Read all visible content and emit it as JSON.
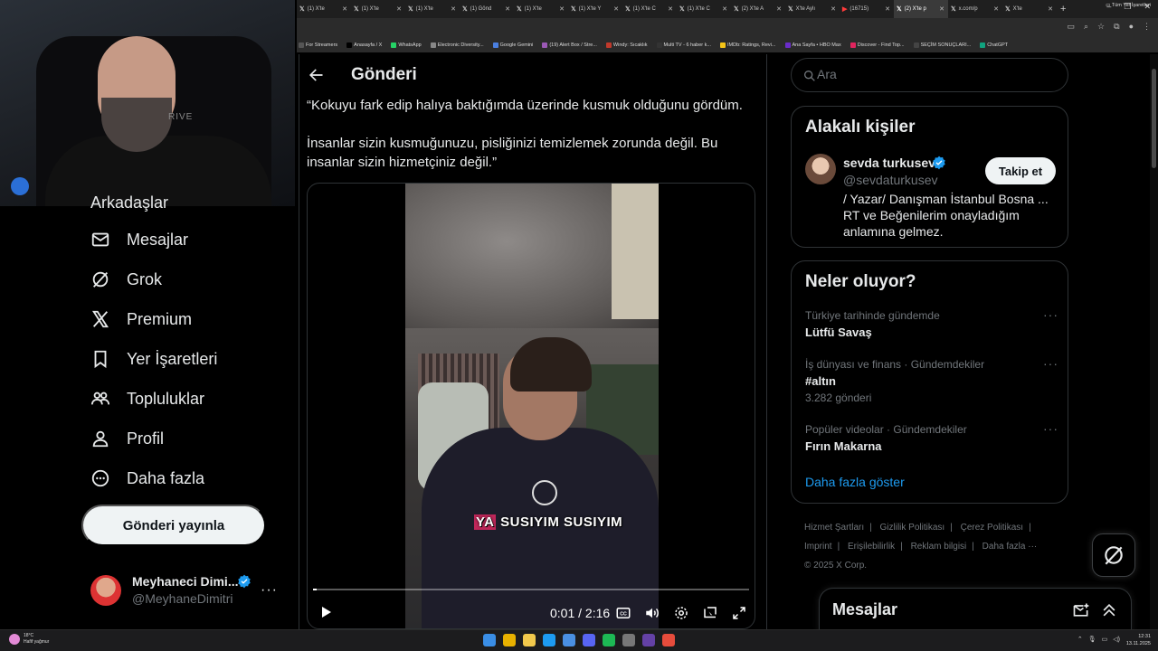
{
  "browser": {
    "tabs": [
      {
        "label": "(1) X'te",
        "icon": "x-icon"
      },
      {
        "label": "(1) X'te",
        "icon": "x-icon"
      },
      {
        "label": "(1) X'te",
        "icon": "x-icon"
      },
      {
        "label": "(1) Gönd",
        "icon": "x-icon"
      },
      {
        "label": "(1) X'te",
        "icon": "x-icon"
      },
      {
        "label": "(1) X'te Y",
        "icon": "x-icon"
      },
      {
        "label": "(1) X'te C",
        "icon": "x-icon"
      },
      {
        "label": "(1) X'te C",
        "icon": "x-icon"
      },
      {
        "label": "(2) X'te A",
        "icon": "x-icon"
      },
      {
        "label": "X'te Aylı",
        "icon": "x-icon"
      },
      {
        "label": "(16715)",
        "icon": "youtube-icon"
      },
      {
        "label": "(2) X'te p",
        "icon": "x-icon",
        "active": true
      },
      {
        "label": "x.com/p",
        "icon": "x-icon"
      },
      {
        "label": "X'te",
        "icon": "x-icon"
      }
    ],
    "bookmarks": [
      {
        "label": "For Streamers",
        "color": "#555555"
      },
      {
        "label": "Anasayfa / X",
        "color": "#000000"
      },
      {
        "label": "WhatsApp",
        "color": "#25d366"
      },
      {
        "label": "Electronic Diversity...",
        "color": "#888888"
      },
      {
        "label": "Google Gemini",
        "color": "#4a7fe0"
      },
      {
        "label": "(19) Alert Box / Stre...",
        "color": "#9b59b6"
      },
      {
        "label": "Windy: Sıcaklık",
        "color": "#c0392b"
      },
      {
        "label": "Multi TV - 6 haber k...",
        "color": "#333333"
      },
      {
        "label": "IMDb: Ratings, Revi...",
        "color": "#f5c518"
      },
      {
        "label": "Ana Sayfa • HBO Max",
        "color": "#6a2cc9"
      },
      {
        "label": "Discover - Find Top...",
        "color": "#e0245e"
      },
      {
        "label": "SEÇİM SONUÇLARI...",
        "color": "#444444"
      },
      {
        "label": "ChatGPT",
        "color": "#10a37f"
      }
    ],
    "bookmarks_more": "Tüm Yer İşaretleri"
  },
  "webcam": {
    "overlay_text": "RIVE"
  },
  "nav": {
    "partial_label": "Arkadaşlar",
    "items": [
      {
        "label": "Mesajlar",
        "icon": "mail-icon"
      },
      {
        "label": "Grok",
        "icon": "grok-icon"
      },
      {
        "label": "Premium",
        "icon": "x-logo-icon"
      },
      {
        "label": "Yer İşaretleri",
        "icon": "bookmark-icon"
      },
      {
        "label": "Topluluklar",
        "icon": "communities-icon"
      },
      {
        "label": "Profil",
        "icon": "profile-icon"
      },
      {
        "label": "Daha fazla",
        "icon": "more-circle-icon"
      }
    ],
    "post_button": "Gönderi yayınla",
    "account": {
      "name": "Meyhaneci Dimi...",
      "handle": "@MeyhaneDimitri",
      "more": "···"
    }
  },
  "post": {
    "header_title": "Gönderi",
    "paragraphs": [
      "“Kokuyu fark edip halıya baktığımda üzerinde kusmuk olduğunu gördüm.",
      "İnsanlar sizin kusmuğunuzu, pisliğinizi temizlemek zorunda değil. Bu insanlar sizin hizmetçiniz değil.”"
    ],
    "video": {
      "caption_highlight": "YA",
      "caption_rest": " SUSIYIM SUSIYIM",
      "time": "0:01 / 2:16",
      "progress": 0.008
    }
  },
  "search": {
    "placeholder": "Ara"
  },
  "related": {
    "title": "Alakalı kişiler",
    "person": {
      "name": "sevda turkusev",
      "handle": "@sevdaturkusev",
      "bio": "/ Yazar/ Danışman İstanbul Bosna ... RT ve Beğenilerim onayladığım anlamına gelmez.",
      "follow": "Takip et"
    }
  },
  "trends": {
    "title": "Neler oluyor?",
    "items": [
      {
        "meta": "Türkiye tarihinde gündemde",
        "title": "Lütfü Savaş",
        "count": ""
      },
      {
        "meta": "İş dünyası ve finans · Gündemdekiler",
        "title": "#altın",
        "count": "3.282 gönderi"
      },
      {
        "meta": "Popüler videolar · Gündemdekiler",
        "title": "Fırın Makarna",
        "count": ""
      }
    ],
    "more_dots": "···",
    "show_more": "Daha fazla göster"
  },
  "footer": {
    "links": [
      "Hizmet Şartları",
      "Gizlilik Politikası",
      "Çerez Politikası",
      "Imprint",
      "Erişilebilirlik",
      "Reklam bilgisi",
      "Daha fazla ···"
    ],
    "copyright": "© 2025 X Corp."
  },
  "messages_drawer": {
    "title": "Mesajlar"
  },
  "taskbar": {
    "weather_temp": "18°C",
    "weather_desc": "Hafif yağmur",
    "time": "12:31",
    "date": "13.11.2025",
    "icon_colors": [
      "#3a8ee6",
      "#e8b100",
      "#f2c94c",
      "#1d9bf0",
      "#4a90e2",
      "#5865f2",
      "#1db954",
      "#777777",
      "#6441a5",
      "#e74c3c"
    ]
  },
  "colors": {
    "accent": "#1d9bf0",
    "background": "#000000",
    "text": "#e7e9ea",
    "muted": "#71767b"
  }
}
